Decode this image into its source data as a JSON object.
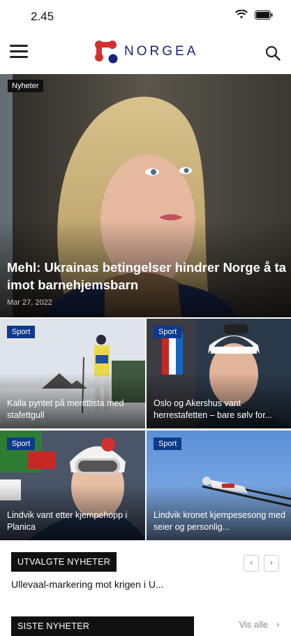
{
  "status": {
    "time": "2.45"
  },
  "header": {
    "logo_text": "NORGEA"
  },
  "hero": {
    "category": "Nyheter",
    "title": "Mehl: Ukrainas betingelser hindrer Norge å ta imot barnehjemsbarn",
    "date": "Mar 27, 2022"
  },
  "cards": [
    {
      "category": "Sport",
      "title": "Kalla pyntet på merittlista med stafettgull"
    },
    {
      "category": "Sport",
      "title": "Oslo og Akershus vant herrestafetten – bare sølv for..."
    },
    {
      "category": "Sport",
      "title": "Lindvik vant etter kjempehopp i Planica"
    },
    {
      "category": "Sport",
      "title": "Lindvik kronet kjempesesong med seier og personlig..."
    }
  ],
  "featured": {
    "label": "UTVALGTE NYHETER",
    "headline": "Ullevaal-markering mot krigen i U..."
  },
  "latest": {
    "label": "SISTE NYHETER",
    "see_all": "Vis alle"
  },
  "colors": {
    "brand_blue": "#1a237e",
    "brand_red": "#d32f2f",
    "badge_blue": "#0d3b8c"
  }
}
